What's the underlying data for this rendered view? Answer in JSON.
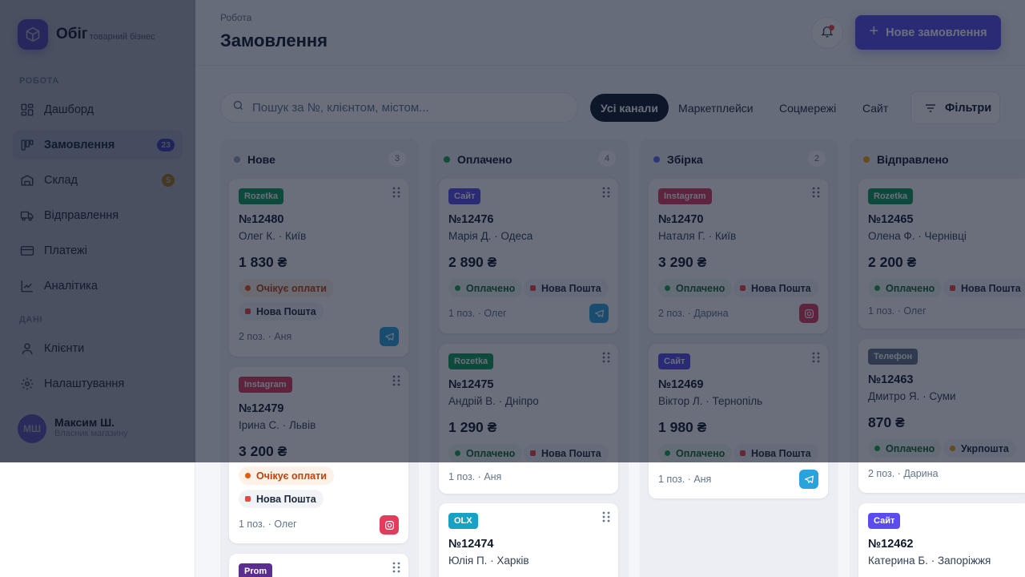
{
  "brand": {
    "name": "Обіг",
    "subtitle": "товарний бізнес"
  },
  "sidebar": {
    "section_work": "РОБОТА",
    "section_data": "ДАНІ",
    "items": [
      {
        "label": "Дашборд",
        "icon": "dashboard-icon"
      },
      {
        "label": "Замовлення",
        "icon": "kanban-icon",
        "badge": "23",
        "active": true
      },
      {
        "label": "Склад",
        "icon": "warehouse-icon",
        "badge": "5"
      },
      {
        "label": "Відправлення",
        "icon": "truck-icon"
      },
      {
        "label": "Платежі",
        "icon": "card-icon"
      },
      {
        "label": "Аналітика",
        "icon": "chart-icon"
      },
      {
        "label": "Клієнти",
        "icon": "user-icon"
      },
      {
        "label": "Налаштування",
        "icon": "gear-icon"
      }
    ],
    "user": {
      "initials": "МШ",
      "name": "Максим Ш.",
      "role": "Власник магазину"
    }
  },
  "header": {
    "breadcrumb": "Робота",
    "title": "Замовлення",
    "new_order_label": "Нове замовлення"
  },
  "toolbar": {
    "search_placeholder": "Пошук за №, клієнтом, містом...",
    "channels": [
      "Усі канали",
      "Маркетплейси",
      "Соцмережі",
      "Сайт"
    ],
    "active_channel": "Усі канали",
    "filters_label": "Фільтри"
  },
  "colors": {
    "accent": "#5b4cf0",
    "rozetka": "#0f9d58",
    "instagram": "#e23b5c",
    "site": "#5b4cf0",
    "prom": "#5b2d90",
    "olx": "#17a2c4",
    "phone": "#64748b"
  },
  "columns": [
    {
      "title": "Нове",
      "count": "3",
      "dot": "#94a3b8",
      "cards": [
        {
          "source": "Rozetka",
          "id": "№12480",
          "customer": "Олег К. · Київ",
          "amount": "1 830 ₴",
          "status": "Очікує оплати",
          "carrier": "Нова Пошта",
          "meta": "2 поз. · Аня",
          "channel_icon": "telegram-icon"
        },
        {
          "source": "Instagram",
          "id": "№12479",
          "customer": "Ірина С. · Львів",
          "amount": "3 200 ₴",
          "status": "Очікує оплати",
          "carrier": "Нова Пошта",
          "meta": "1 поз. · Олег",
          "channel_icon": "instagram-icon"
        },
        {
          "source": "Prom"
        }
      ]
    },
    {
      "title": "Оплачено",
      "count": "4",
      "dot": "#16a34a",
      "cards": [
        {
          "source": "Сайт",
          "id": "№12476",
          "customer": "Марія Д. · Одеса",
          "amount": "2 890 ₴",
          "status": "Оплачено",
          "carrier": "Нова Пошта",
          "meta": "1 поз. · Олег",
          "channel_icon": "telegram-icon"
        },
        {
          "source": "Rozetka",
          "id": "№12475",
          "customer": "Андрій В. · Дніпро",
          "amount": "1 290 ₴",
          "status": "Оплачено",
          "carrier": "Нова Пошта",
          "meta": "1 поз. · Аня"
        },
        {
          "source": "OLX",
          "id": "№12474",
          "customer": "Юлія П. · Харків"
        }
      ]
    },
    {
      "title": "Збірка",
      "count": "2",
      "dot": "#6366f1",
      "cards": [
        {
          "source": "Instagram",
          "id": "№12470",
          "customer": "Наталя Г. · Київ",
          "amount": "3 290 ₴",
          "status": "Оплачено",
          "carrier": "Нова Пошта",
          "meta": "2 поз. · Дарина",
          "channel_icon": "instagram-icon"
        },
        {
          "source": "Сайт",
          "id": "№12469",
          "customer": "Віктор Л. · Тернопіль",
          "amount": "1 980 ₴",
          "status": "Оплачено",
          "carrier": "Нова Пошта",
          "meta": "1 поз. · Аня",
          "channel_icon": "telegram-icon"
        }
      ]
    },
    {
      "title": "Відправлено",
      "count": "",
      "dot": "#f59e0b",
      "cards": [
        {
          "source": "Rozetka",
          "id": "№12465",
          "customer": "Олена Ф. · Чернівці",
          "amount": "2 200 ₴",
          "status": "Оплачено",
          "carrier": "Нова Пошта",
          "meta": "1 поз. · Олег"
        },
        {
          "source": "Телефон",
          "id": "№12463",
          "customer": "Дмитро Я. · Суми",
          "amount": "870 ₴",
          "status": "Оплачено",
          "carrier": "Укрпошта",
          "meta": "2 поз. · Дарина"
        },
        {
          "source": "Сайт",
          "id": "№12462",
          "customer": "Катерина Б. · Запоріжжя"
        }
      ]
    }
  ]
}
